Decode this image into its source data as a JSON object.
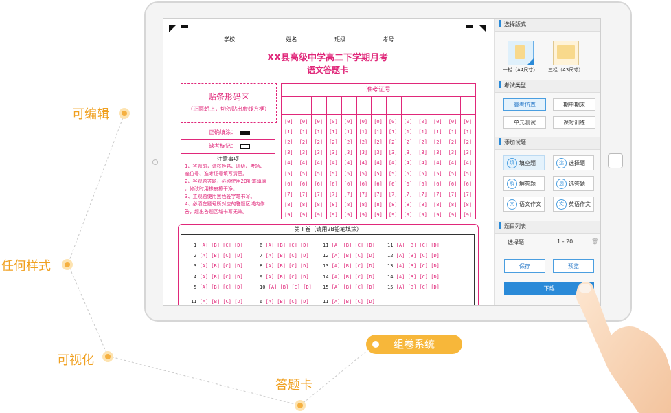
{
  "features": {
    "editable": "可编辑",
    "any_style": "任何样式",
    "visual": "可视化",
    "answer_card": "答题卡",
    "system": "组卷系统"
  },
  "sheet": {
    "fields": {
      "school": "学校",
      "name": "姓名",
      "class": "班级",
      "exam_no": "考号"
    },
    "title": "XX县高级中学高二下学期月考",
    "subtitle": "语文答题卡",
    "barcode": {
      "title": "贴条形码区",
      "note": "（正面朝上，切勿贴出虚线方框）"
    },
    "correct_fill": "正确填涂：",
    "absent_mark": "缺考标记：",
    "notes_title": "注意事项",
    "notes": [
      "1、答题前，请将姓名、班级、考场、",
      "座位号、准考证号填写清楚。",
      "2、客观题答题，必须使用2B铅笔填涂",
      "，修改时用橡皮擦干净。",
      "3、主观题使用黑色签字笔书写。",
      "4、必须在题号所对应的答题区域内作",
      "答，超出答题区域书写无效。"
    ],
    "admission_title": "准考证号",
    "digits": [
      "[0]",
      "[1]",
      "[2]",
      "[3]",
      "[4]",
      "[5]",
      "[6]",
      "[7]",
      "[8]",
      "[9]"
    ],
    "part_title": "第 Ⅰ 卷（请用2B铅笔填涂）",
    "options": "[A] [B] [C] [D]",
    "questions": [
      [
        "1",
        "6",
        "11",
        "11"
      ],
      [
        "2",
        "7",
        "12",
        "12"
      ],
      [
        "3",
        "8",
        "13",
        "13"
      ],
      [
        "4",
        "9",
        "14",
        "14"
      ],
      [
        "5",
        "10",
        "15",
        "15"
      ]
    ],
    "last_row": [
      "11",
      "6",
      "11"
    ]
  },
  "panel": {
    "layout_section": "选择版式",
    "layout_options": [
      "一栏（A4尺寸）",
      "三栏（A3尺寸）"
    ],
    "exam_type_section": "考试类型",
    "exam_types": [
      "高考仿真",
      "期中期末",
      "单元测试",
      "课时训练"
    ],
    "add_section": "添加试题",
    "question_types": [
      {
        "icon": "填",
        "label": "填空题"
      },
      {
        "icon": "选",
        "label": "选择题"
      },
      {
        "icon": "解",
        "label": "解答题"
      },
      {
        "icon": "选",
        "label": "选答题"
      },
      {
        "icon": "文",
        "label": "语文作文"
      },
      {
        "icon": "文",
        "label": "英语作文"
      }
    ],
    "list_section": "题目列表",
    "list_item": {
      "type": "选择题",
      "range": "1 - 20"
    },
    "save": "保存",
    "preview": "预览",
    "download": "下载"
  },
  "colors": {
    "accent": "#2a8ad8",
    "sheet": "#e0287a",
    "orange": "#f0a020"
  }
}
